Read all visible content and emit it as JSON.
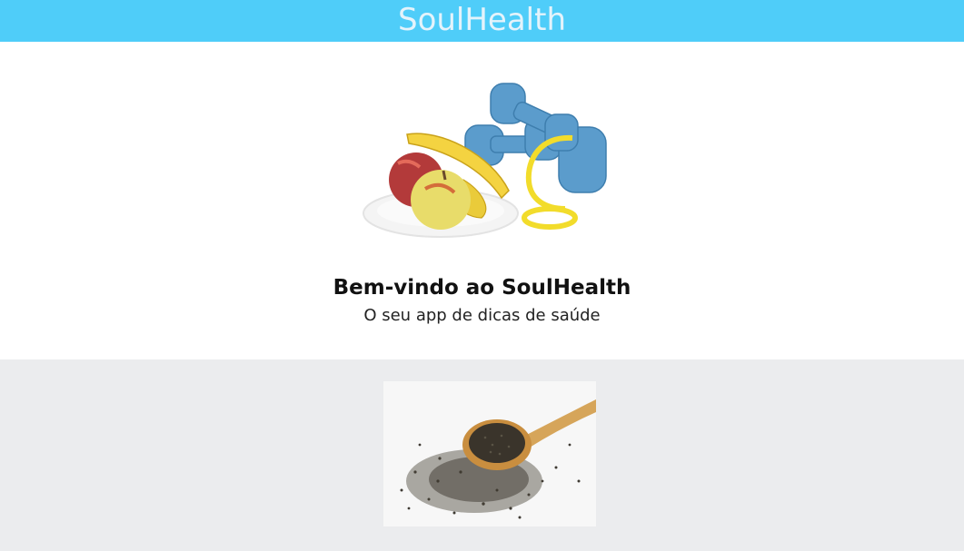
{
  "header": {
    "title": "SoulHealth",
    "color": "#4fcdf9"
  },
  "hero": {
    "image": "fruits-dumbbells-measuring-tape-image",
    "heading": "Bem-vindo ao SoulHealth",
    "subtitle": "O seu app de dicas de saúde"
  },
  "feature": {
    "image": "chia-seeds-wooden-spoon-image",
    "background": "#ebecee"
  }
}
